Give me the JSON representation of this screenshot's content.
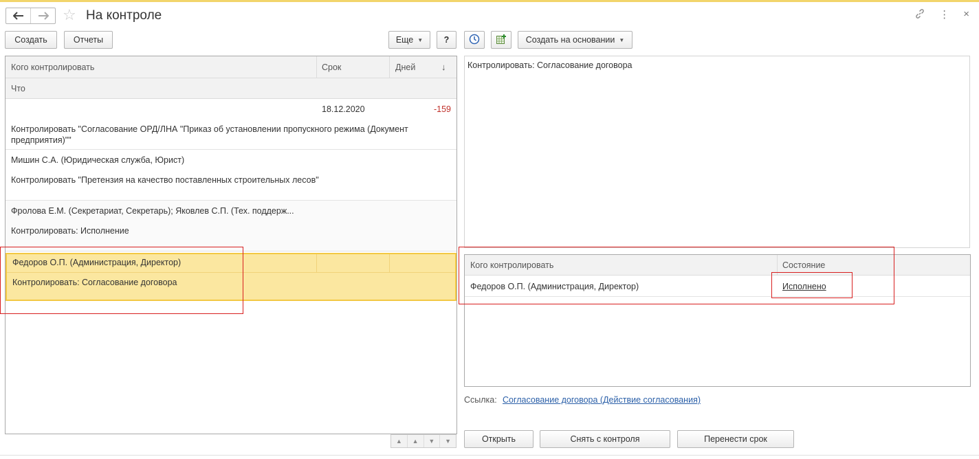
{
  "window": {
    "title": "На контроле",
    "back_icon": "arrow-left-icon",
    "forward_icon": "arrow-right-icon",
    "favorite_icon": "star-icon",
    "link_icon": "link-icon",
    "more_icon": "more-vertical-icon",
    "close_icon": "close-icon"
  },
  "toolbar_left": {
    "create_label": "Создать",
    "reports_label": "Отчеты",
    "more_label": "Еще",
    "help_label": "?"
  },
  "toolbar_right": {
    "history_icon": "clock-icon",
    "add_icon": "add-grid-icon",
    "create_based_label": "Создать на основании"
  },
  "list": {
    "columns": {
      "who": "Кого контролировать",
      "deadline": "Срок",
      "days": "Дней",
      "sort_arrow": "↓",
      "what": "Что"
    },
    "rows": [
      {
        "who": "",
        "deadline": "18.12.2020",
        "days": "-159",
        "what": "Контролировать \"Согласование ОРД/ЛНА \"Приказ об установлении пропускного режима (Документ предприятия)\"\""
      },
      {
        "who": "Мишин С.А. (Юридическая служба, Юрист)",
        "deadline": "",
        "days": "",
        "what": "Контролировать \"Претензия на качество поставленных строительных лесов\""
      },
      {
        "who": "Фролова Е.М. (Секретариат, Секретарь); Яковлев С.П. (Тех. поддерж...",
        "deadline": "",
        "days": "",
        "what": "Контролировать: Исполнение"
      },
      {
        "who": "Федоров О.П. (Администрация, Директор)",
        "deadline": "",
        "days": "",
        "what": "Контролировать: Согласование договора"
      }
    ]
  },
  "detail": {
    "description": "Контролировать: Согласование договора",
    "table": {
      "col_who": "Кого контролировать",
      "col_state": "Состояние",
      "rows": [
        {
          "who": "Федоров О.П. (Администрация, Директор)",
          "state": "Исполнено"
        }
      ]
    },
    "link_label": "Ссылка:",
    "link_value": "Согласование договора (Действие согласования)"
  },
  "actions": {
    "open_label": "Открыть",
    "remove_label": "Снять с контроля",
    "postpone_label": "Перенести срок"
  },
  "colors": {
    "selection": "#fbe7a0",
    "selection_border": "#f3c843",
    "overdue": "#c0302a",
    "link": "#2a5fa8",
    "highlight_box": "#d81e1e"
  }
}
